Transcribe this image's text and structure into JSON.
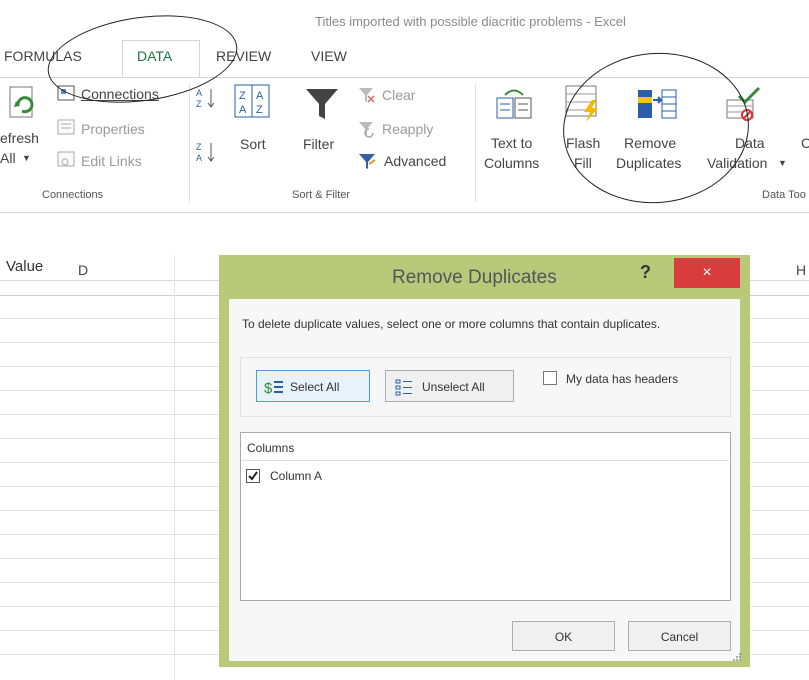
{
  "window": {
    "title": "Titles imported with possible diacritic problems - Excel"
  },
  "tabs": [
    "FORMULAS",
    "DATA",
    "REVIEW",
    "VIEW"
  ],
  "ribbon": {
    "connections": {
      "refresh_line1": "efresh",
      "refresh_line2": "All",
      "connections_label": "Connections",
      "properties_label": "Properties",
      "edit_links_label": "Edit Links",
      "group_label": "Connections"
    },
    "sort_filter": {
      "sort_label": "Sort",
      "filter_label": "Filter",
      "clear_label": "Clear",
      "reapply_label": "Reapply",
      "advanced_label": "Advanced",
      "group_label": "Sort & Filter",
      "sort_az_icon_text": "A Z",
      "sort_za_top": "Z A",
      "sort_icon_letters": "Z A"
    },
    "data_tools": {
      "text_to_columns_1": "Text to",
      "text_to_columns_2": "Columns",
      "flash_fill_1": "Flash",
      "flash_fill_2": "Fill",
      "remove_dup_1": "Remove",
      "remove_dup_2": "Duplicates",
      "data_val_1": "Data",
      "data_val_2": "Validation",
      "next_initial": "C",
      "group_label": "Data Too"
    }
  },
  "formula_bar": {
    "value": "Value"
  },
  "columns": {
    "d": "D",
    "h": "H"
  },
  "dialog": {
    "title": "Remove Duplicates",
    "help": "?",
    "close": "×",
    "instruction": "To delete duplicate values, select one or more columns that contain duplicates.",
    "select_all": "Select All",
    "unselect_all": "Unselect All",
    "headers_checkbox_label": "My data has headers",
    "headers_checked": false,
    "list_header": "Columns",
    "columns_list": [
      {
        "label": "Column A",
        "checked": true
      }
    ],
    "ok": "OK",
    "cancel": "Cancel"
  }
}
